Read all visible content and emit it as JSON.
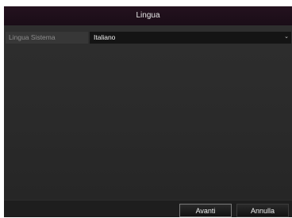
{
  "dialog": {
    "title": "Lingua"
  },
  "form": {
    "language_label": "Lingua Sistema",
    "language_value": "Italiano",
    "dropdown_icon": "chevron-down-icon"
  },
  "footer": {
    "next_label": "Avanti",
    "cancel_label": "Annulla"
  }
}
